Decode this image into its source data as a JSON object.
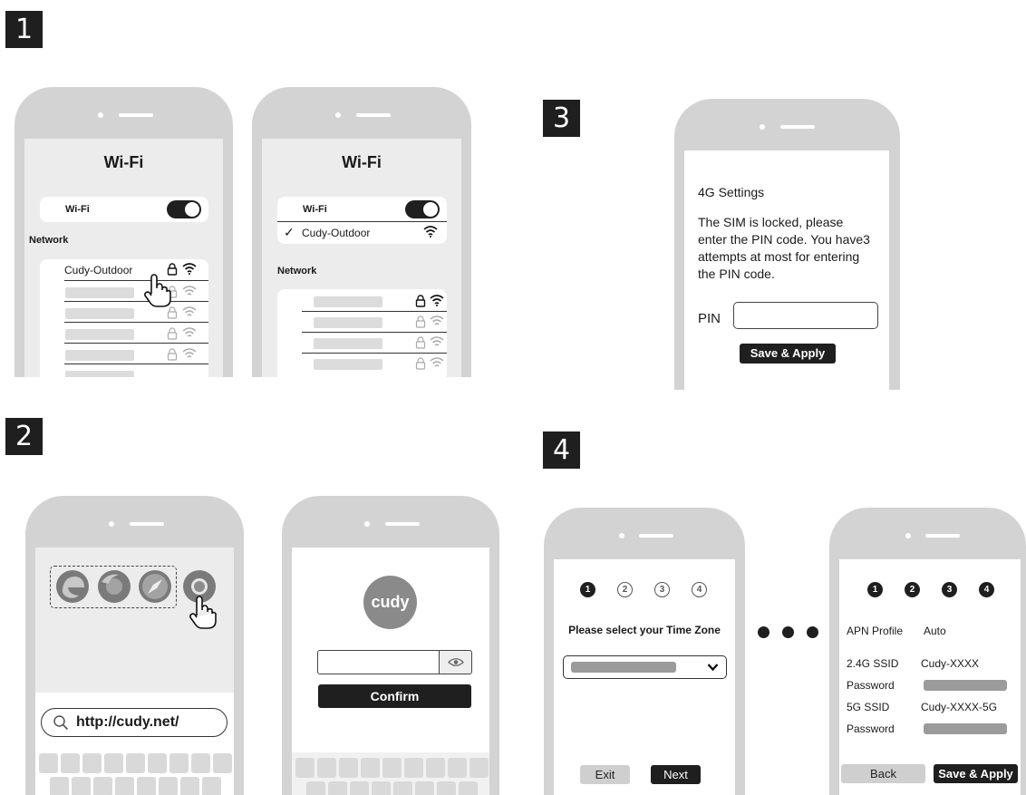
{
  "steps": [
    "1",
    "2",
    "3",
    "4"
  ],
  "phone_a": {
    "title": "Wi-Fi",
    "wifi_label": "Wi-Fi",
    "network_header": "Network",
    "network_name": "Cudy-Outdoor"
  },
  "phone_b": {
    "title": "Wi-Fi",
    "wifi_label": "Wi-Fi",
    "connected_check": "✓",
    "connected_network": "Cudy-Outdoor",
    "network_header": "Network"
  },
  "phone_c": {
    "url": "http://cudy.net/"
  },
  "phone_d": {
    "logo_text": "cudy",
    "confirm_label": "Confirm"
  },
  "phone_e": {
    "heading": "4G Settings",
    "message": "The SIM is locked, please enter the PIN code. You have3 attempts at most for entering the PIN code.",
    "pin_label": "PIN",
    "save_label": "Save & Apply"
  },
  "phone_f": {
    "steps": [
      "1",
      "2",
      "3",
      "4"
    ],
    "prompt": "Please select your Time Zone",
    "exit_label": "Exit",
    "next_label": "Next"
  },
  "phone_g": {
    "steps": [
      "1",
      "2",
      "3",
      "4"
    ],
    "apn_label": "APN Profile",
    "apn_value": "Auto",
    "ssid24_label": "2.4G SSID",
    "ssid24_value": "Cudy-XXXX",
    "password_label_1": "Password",
    "ssid5_label": "5G SSID",
    "ssid5_value": "Cudy-XXXX-5G",
    "password_label_2": "Password",
    "back_label": "Back",
    "save_label": "Save & Apply"
  },
  "icons": [
    "lock-icon",
    "wifi-icon",
    "pointer-hand-icon",
    "edge-browser-icon",
    "firefox-browser-icon",
    "safari-browser-icon",
    "chrome-browser-icon",
    "search-icon",
    "eye-icon",
    "chevron-down-icon",
    "ellipsis-dots"
  ]
}
